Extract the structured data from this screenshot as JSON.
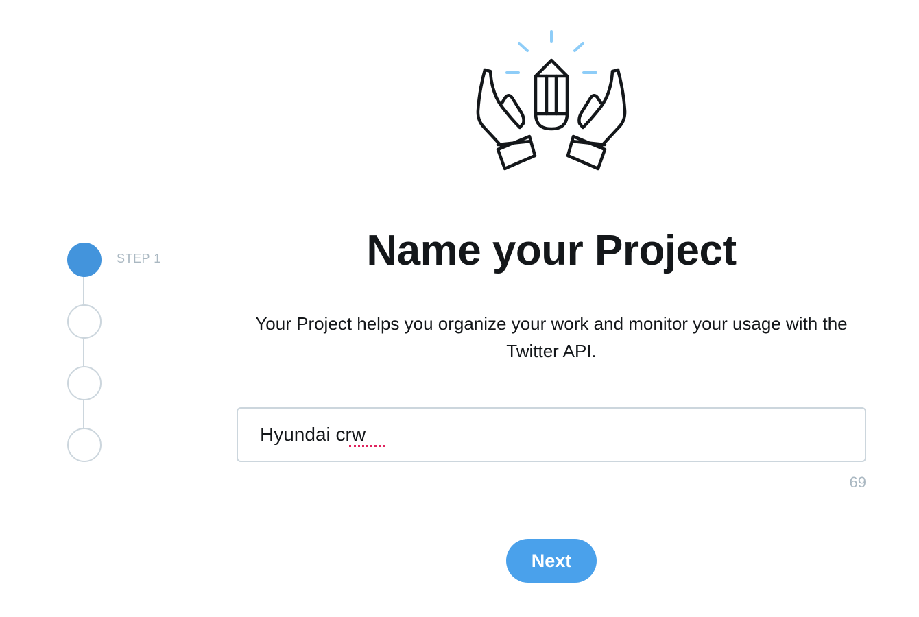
{
  "stepper": {
    "steps": [
      {
        "label": "STEP 1",
        "state": "active"
      },
      {
        "label": "",
        "state": "inactive"
      },
      {
        "label": "",
        "state": "inactive"
      },
      {
        "label": "",
        "state": "inactive"
      }
    ]
  },
  "illustration": {
    "icon": "hands-holding-pencil-icon",
    "colors": {
      "stroke": "#14171a",
      "rays": "#8ecdf8"
    }
  },
  "main": {
    "title": "Name your Project",
    "description": "Your Project helps you organize your work and monitor your usage with the Twitter API.",
    "project_name": {
      "value": "Hyundai crw",
      "remaining_chars": "69"
    },
    "next_label": "Next"
  },
  "colors": {
    "accent": "#4394dc",
    "button": "#4aa1eb",
    "muted_text": "#aab8c2",
    "border": "#ccd6dd",
    "spellcheck": "#e0245e"
  }
}
